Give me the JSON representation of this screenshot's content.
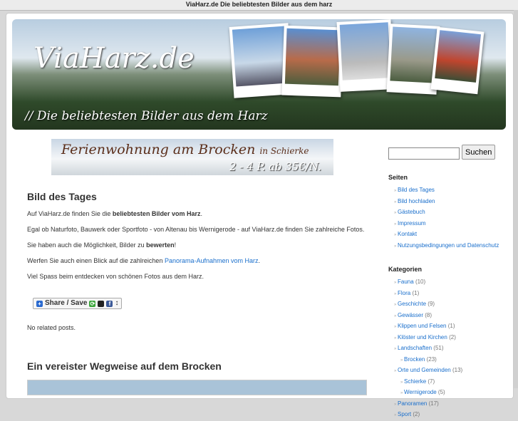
{
  "window": {
    "title": "ViaHarz.de Die beliebtesten Bilder aus dem harz"
  },
  "header": {
    "logo": "ViaHarz.de",
    "tagline": "// Die beliebtesten Bilder aus dem Harz"
  },
  "ad": {
    "line1": "Ferienwohnung am Brocken",
    "line1b": "in Schierke",
    "line2": "2 - 4 P. ab 35€/N."
  },
  "post": {
    "title": "Bild des Tages",
    "p1a": "Auf ViaHarz.de finden Sie die ",
    "p1b": "beliebtesten Bilder vom Harz",
    "p1c": ".",
    "p2": "Egal ob Naturfoto, Bauwerk oder Sportfoto - von Altenau bis Wernigerode - auf ViaHarz.de finden Sie zahlreiche Fotos.",
    "p3a": "Sie haben auch die Möglichkeit, Bilder zu ",
    "p3b": "bewerten",
    "p3c": "!",
    "p4a": "Werfen Sie auch einen Blick auf die zahlreichen ",
    "p4link": "Panorama-Aufnahmen vom Harz",
    "p4c": ".",
    "p5": "Viel Spass beim entdecken von schönen Fotos aus dem Harz.",
    "share": "Share / Save",
    "related": "No related posts."
  },
  "post2": {
    "title": "Ein vereister Wegweise auf dem Brocken"
  },
  "sidebar": {
    "search_button": "Suchen",
    "search_value": "",
    "pages_title": "Seiten",
    "pages": [
      "Bild des Tages",
      "Bild hochladen",
      "Gästebuch",
      "Impressum",
      "Kontakt",
      "Nutzungsbedingungen und Datenschutz"
    ],
    "categories_title": "Kategorien",
    "categories": [
      {
        "label": "Fauna",
        "count": "(10)",
        "sub": false
      },
      {
        "label": "Flora",
        "count": "(1)",
        "sub": false
      },
      {
        "label": "Geschichte",
        "count": "(9)",
        "sub": false
      },
      {
        "label": "Gewässer",
        "count": "(8)",
        "sub": false
      },
      {
        "label": "Klippen und Felsen",
        "count": "(1)",
        "sub": false
      },
      {
        "label": "Klöster und Kirchen",
        "count": "(2)",
        "sub": false
      },
      {
        "label": "Landschaften",
        "count": "(51)",
        "sub": false
      },
      {
        "label": "Brocken",
        "count": "(23)",
        "sub": true
      },
      {
        "label": "Orte und Gemeinden",
        "count": "(13)",
        "sub": false
      },
      {
        "label": "Schierke",
        "count": "(7)",
        "sub": true
      },
      {
        "label": "Wernigerode",
        "count": "(5)",
        "sub": true
      },
      {
        "label": "Panoramen",
        "count": "(17)",
        "sub": false
      },
      {
        "label": "Sport",
        "count": "(2)",
        "sub": false
      }
    ]
  }
}
